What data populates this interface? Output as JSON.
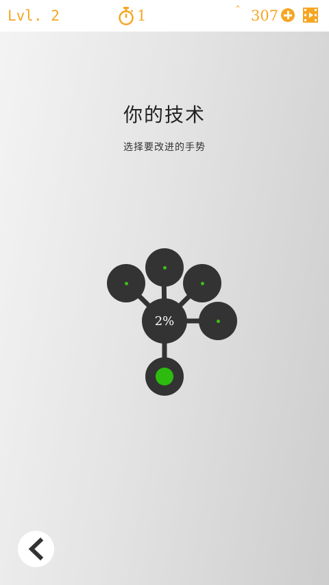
{
  "header": {
    "level_label": "Lvl. 2",
    "timer_count": "1",
    "caret_symbol": "ˆ",
    "coins": "307"
  },
  "main": {
    "title": "你的技术",
    "subtitle": "选择要改进的手势",
    "palm_percent": "2%"
  },
  "colors": {
    "accent": "#f5a623",
    "node": "#333333",
    "green": "#2dbb0f"
  }
}
